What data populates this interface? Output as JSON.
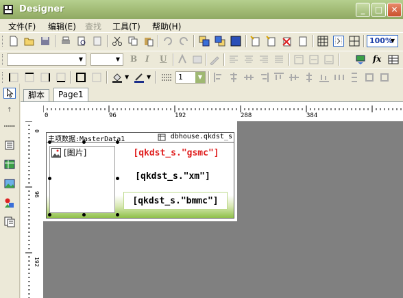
{
  "window": {
    "title": "Designer"
  },
  "menu": {
    "items": [
      {
        "label": "文件(F)",
        "disabled": false
      },
      {
        "label": "编辑(E)",
        "disabled": false
      },
      {
        "label": "查找",
        "disabled": true
      },
      {
        "label": "工具(T)",
        "disabled": false
      },
      {
        "label": "帮助(H)",
        "disabled": false
      }
    ]
  },
  "toolbar": {
    "zoom": "100%",
    "line_width": "1"
  },
  "tabs": [
    {
      "label": "脚本",
      "active": false
    },
    {
      "label": "Page1",
      "active": true
    }
  ],
  "ruler": {
    "h_labels": [
      "0",
      "96",
      "192",
      "288",
      "384"
    ],
    "v_labels": [
      "0",
      "96",
      "192"
    ]
  },
  "band": {
    "title": "主项数据:MasterData1",
    "source": "dbhouse.qkdst_s"
  },
  "picture": {
    "label": "[图片]"
  },
  "fields": [
    {
      "text": "[qkdst_s.\"gsmc\"]",
      "color": "#E02020"
    },
    {
      "text": "[qkdst_s.\"xm\"]",
      "color": "#000000"
    },
    {
      "text": "[qkdst_s.\"bmmc\"]",
      "color": "#000000"
    }
  ],
  "colors": {
    "title_bar": "#9FB872",
    "canvas": "#808080",
    "gsmc": "#E02020"
  }
}
